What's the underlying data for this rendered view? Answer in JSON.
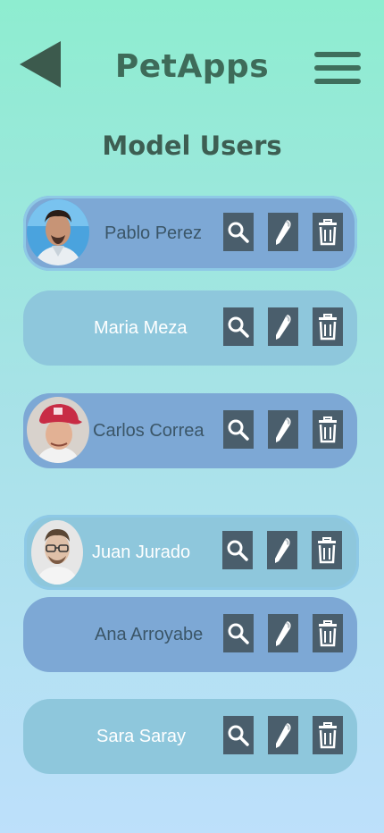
{
  "header": {
    "title": "PetApps",
    "back_icon": "back-triangle-icon",
    "menu_icon": "hamburger-menu-icon"
  },
  "page": {
    "title": "Model Users"
  },
  "colors": {
    "accent": "#3e6b59",
    "card_dark": "#7da8d5",
    "card_light": "#8ec7dc",
    "action_bg": "#4a5e6c"
  },
  "users": [
    {
      "name": "Pablo Perez",
      "has_avatar": true
    },
    {
      "name": "Maria Meza",
      "has_avatar": false
    },
    {
      "name": "Carlos Correa",
      "has_avatar": true
    },
    {
      "name": "Juan Jurado",
      "has_avatar": true
    },
    {
      "name": "Ana Arroyabe",
      "has_avatar": false
    },
    {
      "name": "Sara Saray",
      "has_avatar": false
    }
  ],
  "actions": {
    "view_icon": "search-icon",
    "edit_icon": "pen-icon",
    "delete_icon": "trash-icon"
  }
}
